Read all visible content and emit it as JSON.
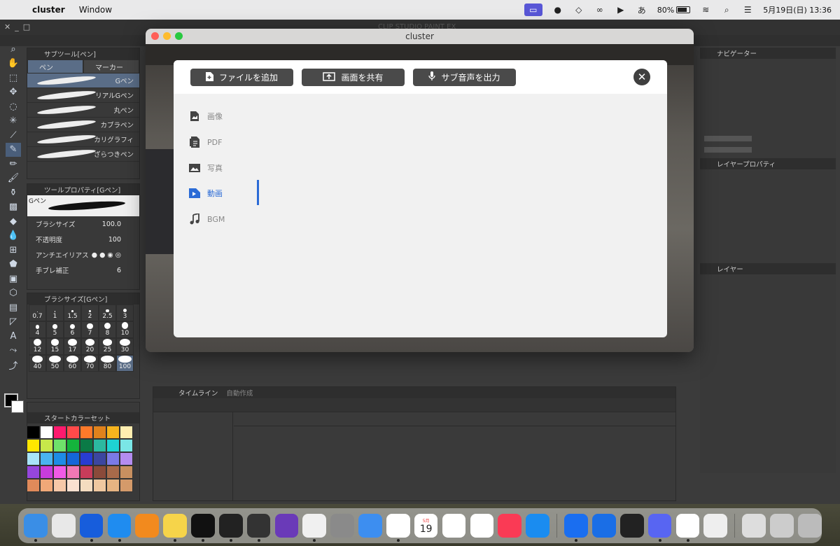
{
  "menubar": {
    "app_name": "cluster",
    "menus": [
      "Window"
    ],
    "battery_percent": "80%",
    "datetime": "5月19日(日)  13:36",
    "ime_label": "あ"
  },
  "csp": {
    "title": "CLIP STUDIO PAINT EX",
    "subtool_panel": {
      "title": "サブツール[ペン]",
      "tabs": [
        {
          "label": "ペン",
          "selected": true
        },
        {
          "label": "マーカー",
          "selected": false
        }
      ],
      "pens": [
        {
          "label": "Gペン",
          "selected": true
        },
        {
          "label": "リアルGペン",
          "selected": false
        },
        {
          "label": "丸ペン",
          "selected": false
        },
        {
          "label": "カブラペン",
          "selected": false
        },
        {
          "label": "カリグラフィ",
          "selected": false
        },
        {
          "label": "ざらつきペン",
          "selected": false
        }
      ]
    },
    "tool_property": {
      "title": "ツールプロパティ[Gペン]",
      "preview_label": "Gペン",
      "rows": [
        {
          "label": "ブラシサイズ",
          "value": "100.0"
        },
        {
          "label": "不透明度",
          "value": "100"
        },
        {
          "label": "アンチエイリアス",
          "value": ""
        },
        {
          "label": "手ブレ補正",
          "value": "6"
        }
      ]
    },
    "brush_size": {
      "title": "ブラシサイズ[Gペン]",
      "sizes": [
        "0.7",
        "1",
        "1.5",
        "2",
        "2.5",
        "3",
        "4",
        "5",
        "6",
        "7",
        "8",
        "10",
        "12",
        "15",
        "17",
        "20",
        "25",
        "30",
        "40",
        "50",
        "60",
        "70",
        "80",
        "100"
      ],
      "selected": "100"
    },
    "color_set": {
      "title": "スタートカラーセット",
      "colors": [
        "#000000",
        "#ffffff",
        "#ff1a6e",
        "#ff4a4a",
        "#ff7a2a",
        "#e0821c",
        "#f6b41e",
        "#ffeeb0",
        "#ffe600",
        "#c7e84a",
        "#6fe26a",
        "#14b43c",
        "#0a7a46",
        "#2cb8a0",
        "#1ed2d2",
        "#7ae6e6",
        "#a8e4f8",
        "#4ab4f0",
        "#1e8ce6",
        "#1466d8",
        "#283cd2",
        "#3c46a0",
        "#7a7ae6",
        "#b48cf0",
        "#9646dc",
        "#c83cdc",
        "#f05ae6",
        "#f078b4",
        "#c83c5a",
        "#8a4a3a",
        "#a86a4a",
        "#c89060",
        "#e08a5a",
        "#f0a878",
        "#f6c8a8",
        "#fae0d0",
        "#f4dcc0",
        "#f0c8a0",
        "#e6b482",
        "#d49a6a"
      ]
    },
    "navigator_title": "ナビゲーター",
    "layer_property_title": "レイヤープロパティ",
    "layer_title": "レイヤー",
    "timeline": {
      "title": "タイムライン",
      "tab2": "自動作成"
    }
  },
  "cluster_window": {
    "title": "cluster"
  },
  "modal": {
    "buttons": [
      {
        "label": "ファイルを追加",
        "icon": "file-add-icon"
      },
      {
        "label": "画面を共有",
        "icon": "screen-share-icon"
      },
      {
        "label": "サブ音声を出力",
        "icon": "microphone-icon"
      }
    ],
    "categories": [
      {
        "label": "画像",
        "icon": "image-file-icon",
        "selected": false
      },
      {
        "label": "PDF",
        "icon": "pdf-file-icon",
        "selected": false
      },
      {
        "label": "写真",
        "icon": "photo-icon",
        "selected": false
      },
      {
        "label": "動画",
        "icon": "video-icon",
        "selected": true
      },
      {
        "label": "BGM",
        "icon": "music-note-icon",
        "selected": false
      }
    ],
    "accent": "#2b6bd6"
  },
  "dock": {
    "apps": [
      "Finder",
      "Launchpad",
      "Bitwarden",
      "Safari",
      "Pages",
      "Notes",
      "Unknown",
      "Terminal",
      "Server",
      "Obsidian",
      "Clip Studio",
      "System Settings",
      "Mail",
      "Photos",
      "Calendar",
      "Reminders",
      "Freeform",
      "Music",
      "App Store",
      "Cluster",
      "Books",
      "Unity",
      "Discord",
      "Chrome",
      "Misc",
      "Preview",
      "Downloads",
      "Trash"
    ],
    "calendar_day": "19",
    "calendar_month": "5月"
  }
}
